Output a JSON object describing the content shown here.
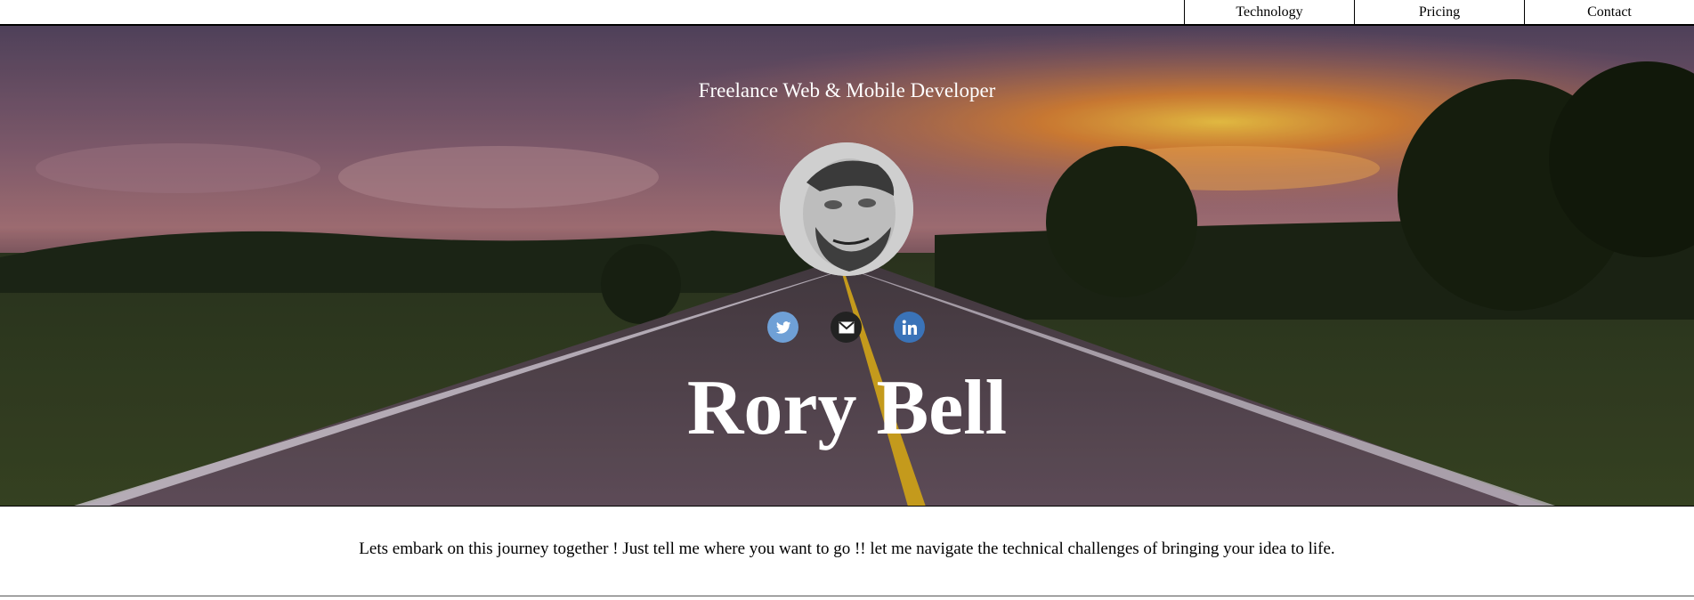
{
  "nav": {
    "items": [
      {
        "label": "Technology"
      },
      {
        "label": "Pricing"
      },
      {
        "label": "Contact"
      }
    ]
  },
  "hero": {
    "tagline": "Freelance Web & Mobile Developer",
    "name": "Rory Bell",
    "socials": [
      {
        "icon": "twitter-icon",
        "color": "#6fa0d6"
      },
      {
        "icon": "email-icon",
        "color": "#222222"
      },
      {
        "icon": "linkedin-icon",
        "color": "#3a73b8"
      }
    ]
  },
  "intro": {
    "text": "Lets embark on this journey together ! Just tell me where you want to go !! let me navigate the technical challenges of bringing your idea to life."
  }
}
